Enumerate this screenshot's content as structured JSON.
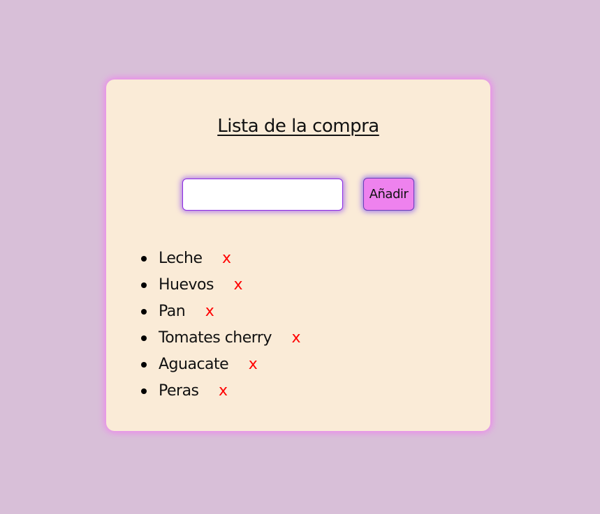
{
  "page": {
    "title": "Lista de la compra"
  },
  "form": {
    "input_value": "",
    "input_placeholder": "",
    "add_label": "Añadir"
  },
  "items": [
    {
      "label": "Leche",
      "delete": "x"
    },
    {
      "label": "Huevos",
      "delete": "x"
    },
    {
      "label": "Pan",
      "delete": "x"
    },
    {
      "label": "Tomates cherry",
      "delete": "x"
    },
    {
      "label": "Aguacate",
      "delete": "x"
    },
    {
      "label": "Peras",
      "delete": "x"
    }
  ],
  "colors": {
    "background": "#d8bfd8",
    "card": "#faebd7",
    "accent": "#ee82ee",
    "input_border": "#8a2be2",
    "delete": "#ff0000"
  }
}
